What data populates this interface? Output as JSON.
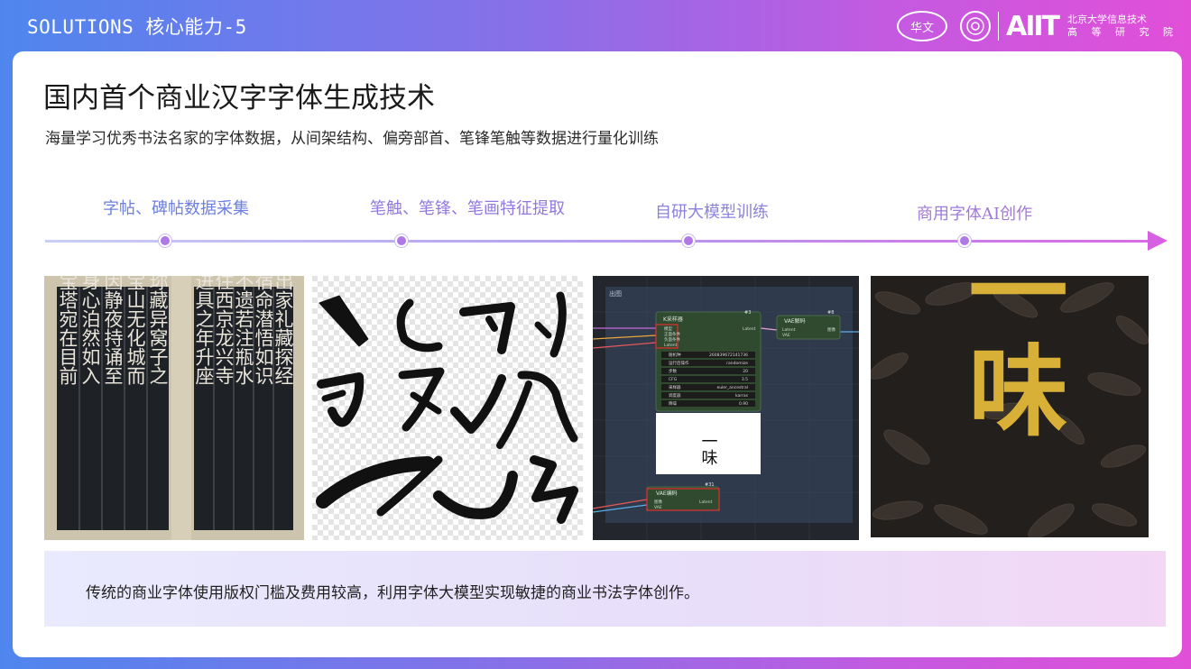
{
  "header": {
    "title": "SOLUTIONS 核心能力-5",
    "logo_badge": "华文",
    "logo_brand": "AIIT",
    "logo_org_line1": "北京大学信息技术",
    "logo_org_line2": "高 等 研 究 院"
  },
  "main": {
    "title": "国内首个商业汉字字体生成技术",
    "subtitle": "海量学习优秀书法名家的字体数据，从间架结构、偏旁部首、笔锋笔触等数据进行量化训练"
  },
  "timeline": {
    "steps": [
      {
        "label": "字帖、碑帖数据采集"
      },
      {
        "label": "笔触、笔锋、笔画特征提取"
      },
      {
        "label": "自研大模型训练"
      },
      {
        "label": "商用字体AI创作"
      }
    ]
  },
  "panels": {
    "calligraphy_left_page": [
      "众俗自播出家礼藏探经",
      "法华在手宿命潜悟如识",
      "金環揔持不遗若注瓶水",
      "九岁落发住西京龙兴寺",
      "从僧箓也进具之年升座"
    ],
    "calligraphy_right_page": [
      "讲法頻收珎藏异窝子之",
      "疾走直詣宝山无化城而",
      "可息尔后因静夜持诵至",
      "多宝塔品身心泊然如入",
      "禅定忽见宝塔宛在目前"
    ],
    "workflow": {
      "group_label": "出图",
      "node_sampler_title": "K采样器",
      "node_sampler_id": "#3",
      "node_decode_title": "VAE解码",
      "node_decode_id": "#8",
      "node_encode_title": "VAE编码",
      "node_encode_id": "#31",
      "inputs": [
        "模型",
        "正面条件",
        "负面条件",
        "Latent"
      ],
      "params": [
        {
          "name": "随机种",
          "value": "260839672141736"
        },
        {
          "name": "运行后操作",
          "value": "randomize"
        },
        {
          "name": "步数",
          "value": "20"
        },
        {
          "name": "CFG",
          "value": "3.5"
        },
        {
          "name": "采样器",
          "value": "euler_ancestral"
        },
        {
          "name": "调度器",
          "value": "karras"
        },
        {
          "name": "降噪",
          "value": "0.90"
        }
      ],
      "latent_out": "Latent",
      "image_out": "图像",
      "vae_label": "VAE",
      "preview_text": "一味"
    },
    "product_text": "一味"
  },
  "bottom": {
    "text": "传统的商业字体使用版权门槛及费用较高，利用字体大模型实现敏捷的商业书法字体创作。"
  },
  "colors": {
    "accent_purple": "#b078e6",
    "gold": "#d8b037"
  }
}
